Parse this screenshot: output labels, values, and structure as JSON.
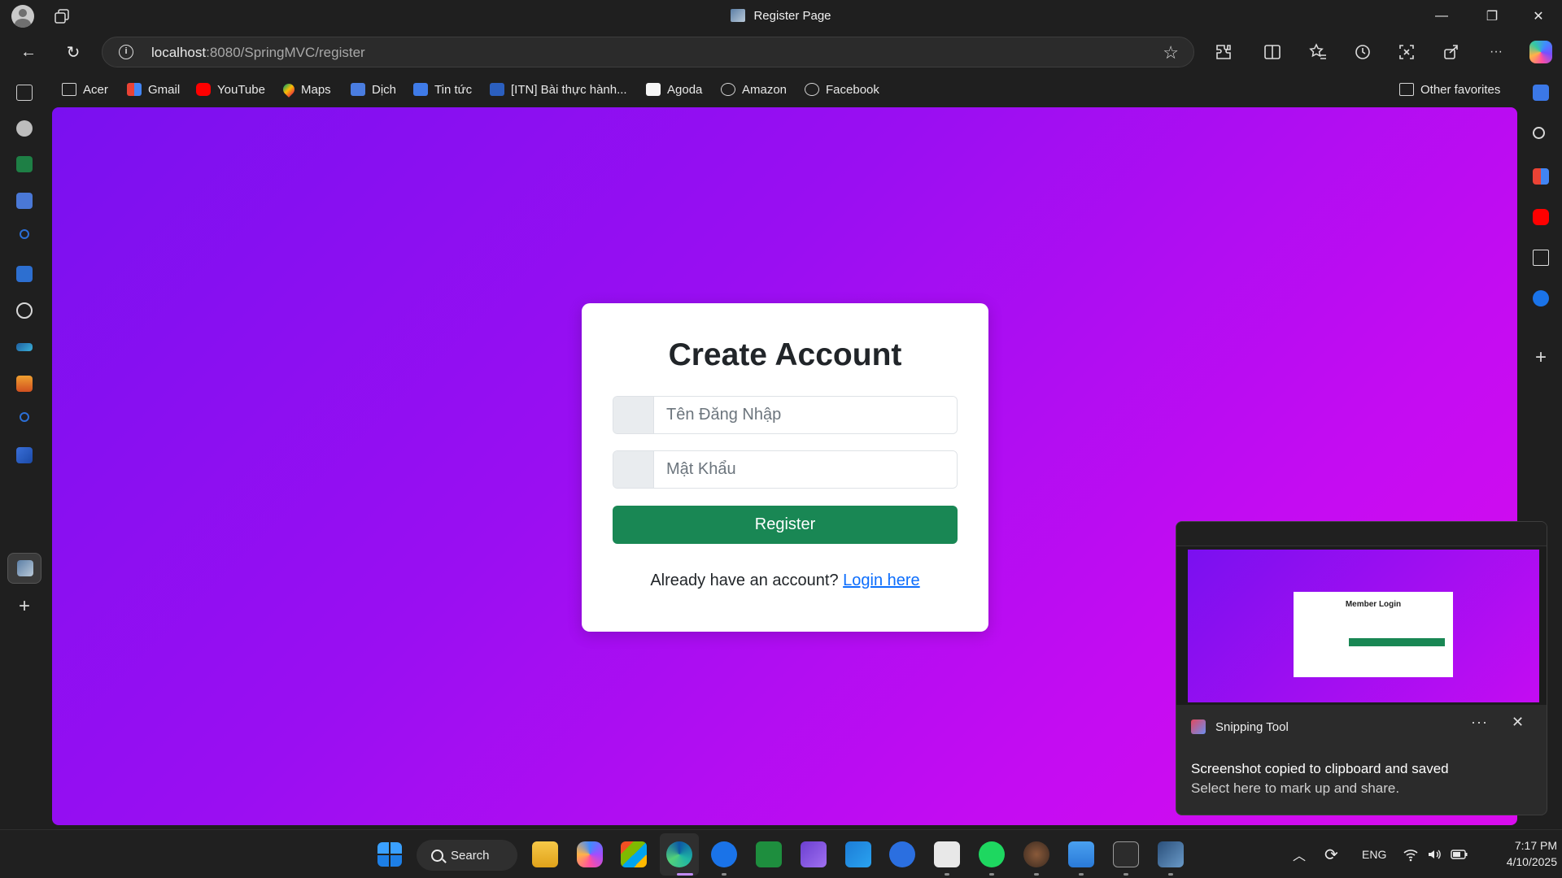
{
  "window": {
    "title": "Register Page",
    "minimize": "—",
    "restore": "❐",
    "close": "✕"
  },
  "nav": {
    "back": "←",
    "refresh": "↻",
    "url_host": "localhost",
    "url_rest": ":8080/SpringMVC/register",
    "star": "☆",
    "more": "···"
  },
  "bookmarks": [
    {
      "label": "Acer",
      "icon": "folder-icon"
    },
    {
      "label": "Gmail",
      "icon": "gmail-icon"
    },
    {
      "label": "YouTube",
      "icon": "youtube-icon"
    },
    {
      "label": "Maps",
      "icon": "maps-icon"
    },
    {
      "label": "Dịch",
      "icon": "translate-icon"
    },
    {
      "label": "Tin tức",
      "icon": "news-icon"
    },
    {
      "label": "[ITN] Bài thực hành...",
      "icon": "word-icon"
    },
    {
      "label": "Agoda",
      "icon": "agoda-icon"
    },
    {
      "label": "Amazon",
      "icon": "globe-icon"
    },
    {
      "label": "Facebook",
      "icon": "globe-icon"
    }
  ],
  "other_favorites": "Other favorites",
  "form": {
    "title": "Create Account",
    "username_placeholder": "Tên Đăng Nhập",
    "password_placeholder": "Mật Khẩu",
    "submit_label": "Register",
    "login_prompt": "Already have an account?",
    "login_link": "Login here"
  },
  "toast": {
    "app_name": "Snipping Tool",
    "more": "···",
    "close": "✕",
    "message": "Screenshot copied to clipboard and saved",
    "sub_message": "Select here to mark up and share.",
    "thumbnail_card_title": "Member Login"
  },
  "taskbar": {
    "search_label": "Search",
    "language": "ENG",
    "time": "7:17 PM",
    "date": "4/10/2025"
  },
  "colors": {
    "gradient_start": "#7a10f0",
    "gradient_end": "#d90cee",
    "register_button": "#198754",
    "link": "#0d6efd"
  }
}
